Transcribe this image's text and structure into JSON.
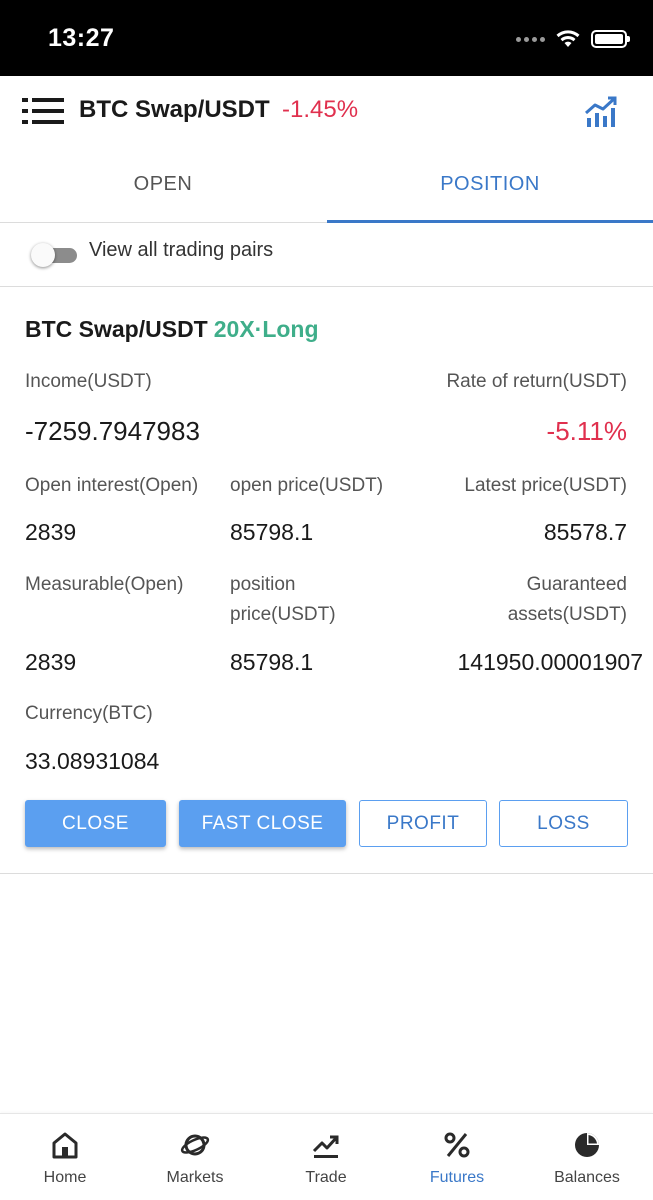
{
  "status_bar": {
    "time": "13:27"
  },
  "header": {
    "title": "BTC Swap/USDT",
    "change": "-1.45%",
    "colors": {
      "negative": "#e0304e",
      "accent": "#3a78c8"
    }
  },
  "tabs": [
    {
      "label": "OPEN",
      "active": false
    },
    {
      "label": "POSITION",
      "active": true
    }
  ],
  "filter": {
    "label": "View all trading pairs",
    "enabled": false
  },
  "position": {
    "pair": "BTC Swap/USDT",
    "tag": "20X·Long",
    "income_label": "Income(USDT)",
    "income_value": "-7259.7947983",
    "rate_label": "Rate of return(USDT)",
    "rate_value": "-5.11%",
    "open_interest_label": "Open interest(Open)",
    "open_interest_value": "2839",
    "open_price_label": "open price(USDT)",
    "open_price_value": "85798.1",
    "latest_price_label": "Latest price(USDT)",
    "latest_price_value": "85578.7",
    "measurable_label": "Measurable(Open)",
    "measurable_value": "2839",
    "position_price_label_1": "position",
    "position_price_label_2": "price(USDT)",
    "position_price_value": "85798.1",
    "guaranteed_label_1": "Guaranteed",
    "guaranteed_label_2": "assets(USDT)",
    "guaranteed_value": "141950.00001907",
    "currency_label": "Currency(BTC)",
    "currency_value": "33.08931084"
  },
  "actions": {
    "close": "CLOSE",
    "fast_close": "FAST CLOSE",
    "profit": "PROFIT",
    "loss": "LOSS"
  },
  "bottom_nav": [
    {
      "label": "Home",
      "icon": "home-icon",
      "active": false
    },
    {
      "label": "Markets",
      "icon": "planet-icon",
      "active": false
    },
    {
      "label": "Trade",
      "icon": "trend-chart-icon",
      "active": false
    },
    {
      "label": "Futures",
      "icon": "percent-icon",
      "active": true
    },
    {
      "label": "Balances",
      "icon": "pie-chart-icon",
      "active": false
    }
  ]
}
